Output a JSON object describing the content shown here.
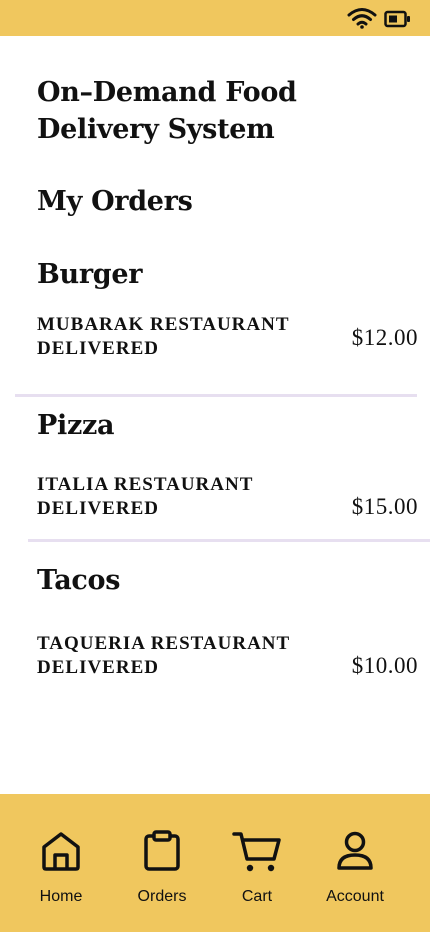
{
  "status_bar": {
    "icons": [
      "wifi-icon",
      "battery-icon"
    ],
    "background": "#f0c75e"
  },
  "header": {
    "app_title": "On–Demand Food\nDelivery System",
    "section_title": "My Orders"
  },
  "orders": [
    {
      "name": "Burger",
      "restaurant": "MUBARAK RESTAURANT",
      "status": "DELIVERED",
      "price": "$12.00"
    },
    {
      "name": "Pizza",
      "restaurant": "ITALIA RESTAURANT",
      "status": "DELIVERED",
      "price": "$15.00"
    },
    {
      "name": "Tacos",
      "restaurant": "TAQUERIA RESTAURANT",
      "status": "DELIVERED",
      "price": "$10.00"
    }
  ],
  "bottom_nav": {
    "items": [
      {
        "label": "Home",
        "icon": "home-icon"
      },
      {
        "label": "Orders",
        "icon": "clipboard-icon"
      },
      {
        "label": "Cart",
        "icon": "cart-icon"
      },
      {
        "label": "Account",
        "icon": "user-icon"
      }
    ],
    "background": "#f0c75e"
  },
  "colors": {
    "accent": "#f0c75e",
    "divider": "#e7dff0",
    "text": "#111111",
    "background": "#ffffff"
  }
}
